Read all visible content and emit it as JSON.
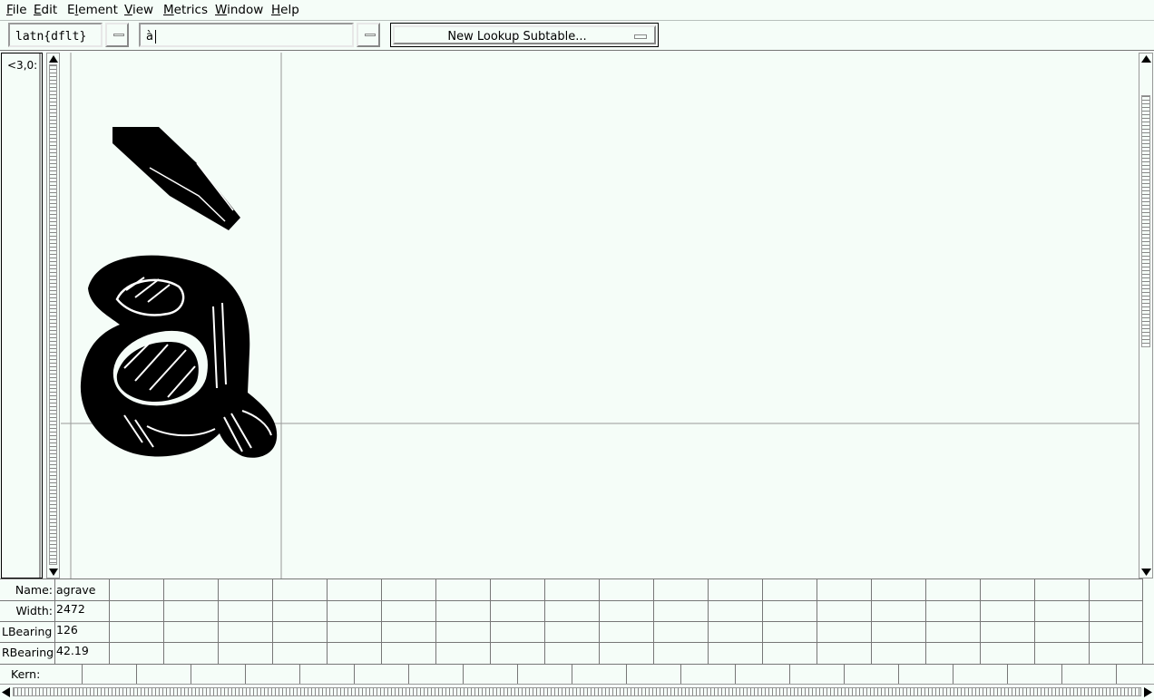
{
  "menubar": {
    "items": [
      {
        "label": "File",
        "underline": "F"
      },
      {
        "label": "Edit",
        "underline": "E"
      },
      {
        "label": "Element",
        "underline": "l"
      },
      {
        "label": "View",
        "underline": "V"
      },
      {
        "label": "Metrics",
        "underline": "M"
      },
      {
        "label": "Window",
        "underline": "W"
      },
      {
        "label": "Help",
        "underline": "H"
      }
    ]
  },
  "toolbar": {
    "script_value": "latn{dflt}",
    "text_value": "à",
    "lookup_label": "New Lookup Subtable..."
  },
  "glyph_list": {
    "first_item": "<3,0:"
  },
  "canvas": {
    "glyph_char": "à",
    "glyph_name": "agrave"
  },
  "metrics": {
    "name_label": "Name:",
    "name_value": "agrave",
    "width_label": "Width:",
    "width_value": "2472",
    "lbearing_label": "LBearing",
    "lbearing_value": "126",
    "rbearing_label": "RBearing",
    "rbearing_value": "42.19",
    "kern_label": "Kern:"
  },
  "icons": {
    "scroll_up": "triangle-up-icon",
    "scroll_down": "triangle-down-icon",
    "scroll_left": "triangle-left-icon",
    "scroll_right": "triangle-right-icon"
  }
}
